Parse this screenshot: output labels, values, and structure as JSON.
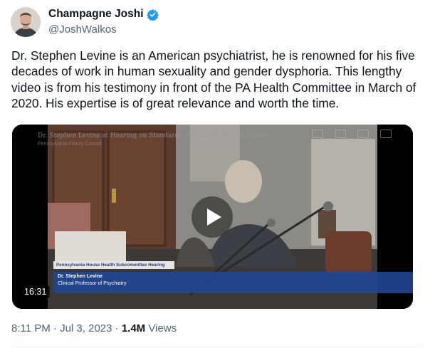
{
  "author": {
    "display_name": "Champagne Joshi",
    "handle": "@JoshWalkos",
    "verified": true,
    "verified_color": "#1d9bf0",
    "avatar_icon": "user-avatar"
  },
  "tweet": {
    "text": "Dr. Stephen Levine is an American psychiatrist, he is renowned for his five decades of work in human sexuality and gender dysphoria. This lengthy video is from his testimony in front of the PA Health Committee in March of 2020. His expertise is of great relevance and worth the time."
  },
  "video": {
    "title": "Dr. Stephen Levine at Hearing on Standards of Care for Minors Experie",
    "channel": "Pennsylvania Family Council",
    "banner_label": "Pennsylvania House Health Subcommittee Hearing",
    "speaker_name": "Dr. Stephen Levine",
    "speaker_role": "Clinical Professor of Psychiatry",
    "duration": "16:31",
    "play_icon": "play-icon",
    "banner_color": "#1f4796"
  },
  "meta": {
    "time": "8:11 PM",
    "sep1": "·",
    "date": "Jul 3, 2023",
    "sep2": "·",
    "views_count": "1.4M",
    "views_label": "Views"
  }
}
